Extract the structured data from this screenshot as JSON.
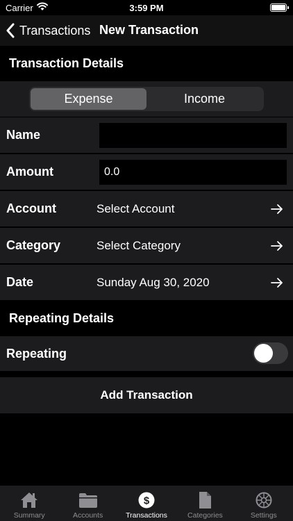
{
  "status_bar": {
    "carrier": "Carrier",
    "time": "3:59 PM"
  },
  "nav": {
    "back_label": "Transactions",
    "title": "New Transaction"
  },
  "sections": {
    "details": "Transaction Details",
    "repeating": "Repeating Details"
  },
  "segment": {
    "expense": "Expense",
    "income": "Income",
    "selected": "Expense"
  },
  "form": {
    "name_label": "Name",
    "name_value": "",
    "amount_label": "Amount",
    "amount_value": "0.0",
    "account_label": "Account",
    "account_value": "Select Account",
    "category_label": "Category",
    "category_value": "Select Category",
    "date_label": "Date",
    "date_value": "Sunday Aug 30, 2020",
    "repeating_label": "Repeating",
    "repeating_on": false
  },
  "add_button": "Add Transaction",
  "tabs": [
    {
      "label": "Summary",
      "icon": "house-icon"
    },
    {
      "label": "Accounts",
      "icon": "folder-icon"
    },
    {
      "label": "Transactions",
      "icon": "dollar-circle-icon",
      "active": true
    },
    {
      "label": "Categories",
      "icon": "document-icon"
    },
    {
      "label": "Settings",
      "icon": "gear-icon"
    }
  ],
  "colors": {
    "background": "#000000",
    "row": "#1c1c1e",
    "segment_active": "#636366",
    "tab_inactive": "#8e8e93"
  }
}
